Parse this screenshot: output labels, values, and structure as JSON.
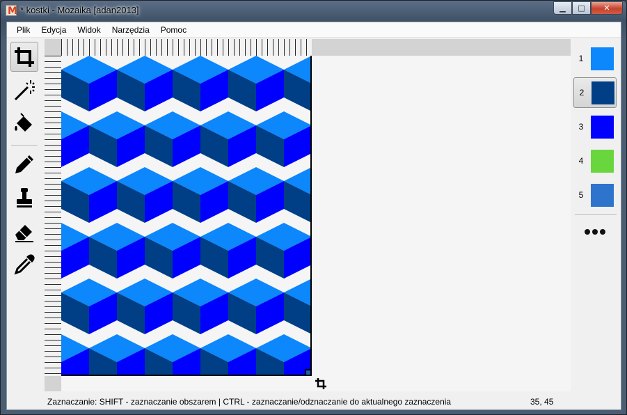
{
  "window": {
    "title": "* kostki - Mozaika [adan2013]",
    "app_icon_letter": "M",
    "controls": {
      "minimize": "▁",
      "maximize": "□",
      "close": "✕"
    }
  },
  "menu": [
    {
      "label": "Plik"
    },
    {
      "label": "Edycja"
    },
    {
      "label": "Widok"
    },
    {
      "label": "Narzędzia"
    },
    {
      "label": "Pomoc"
    }
  ],
  "tools": [
    {
      "name": "crop-tool",
      "icon": "crop-icon",
      "active": true
    },
    {
      "name": "magic-wand-tool",
      "icon": "magic-wand-icon",
      "active": false
    },
    {
      "name": "fill-tool",
      "icon": "paint-bucket-icon",
      "active": false
    },
    {
      "name": "pencil-tool",
      "icon": "pencil-icon",
      "active": false
    },
    {
      "name": "stamp-tool",
      "icon": "stamp-icon",
      "active": false
    },
    {
      "name": "eraser-tool",
      "icon": "eraser-icon",
      "active": false
    },
    {
      "name": "eyedropper-tool",
      "icon": "eyedropper-icon",
      "active": false
    }
  ],
  "canvas": {
    "pattern": "isometric-cubes",
    "colors": {
      "top": "#0c87fc",
      "left": "#003f86",
      "right": "#0000ff"
    }
  },
  "palette": {
    "selected": "2",
    "items": [
      {
        "number": "1",
        "color": "#0c87fc"
      },
      {
        "number": "2",
        "color": "#003f86"
      },
      {
        "number": "3",
        "color": "#0000ff"
      },
      {
        "number": "4",
        "color": "#6ad63e"
      },
      {
        "number": "5",
        "color": "#2e74cc"
      }
    ],
    "more_icon": "more-dots-icon"
  },
  "status": {
    "text": "Zaznaczanie: SHIFT - zaznaczanie obszarem | CTRL - zaznaczanie/odznaczanie do aktualnego zaznaczenia",
    "coords": "35, 45"
  }
}
